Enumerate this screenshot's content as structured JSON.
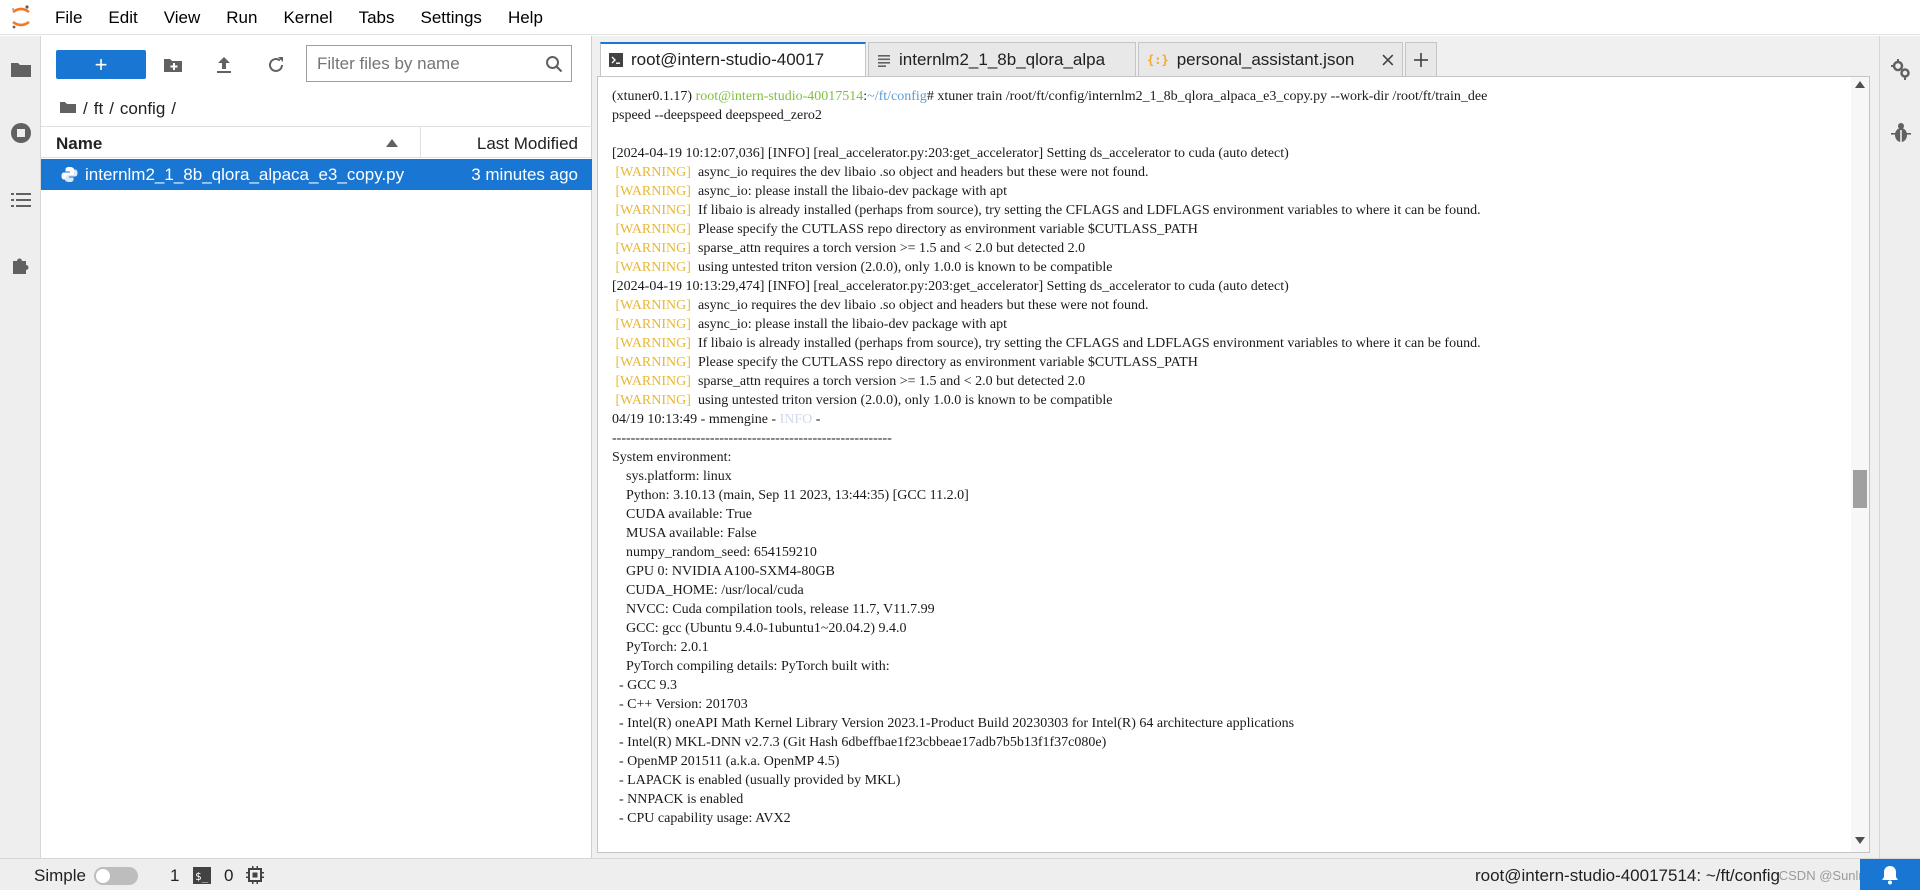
{
  "menu": {
    "items": [
      "File",
      "Edit",
      "View",
      "Run",
      "Kernel",
      "Tabs",
      "Settings",
      "Help"
    ]
  },
  "left_strip": {
    "icons": [
      "folder-icon",
      "running-icon",
      "toc-icon",
      "extension-icon"
    ]
  },
  "file_browser": {
    "new_label": "+",
    "filter_placeholder": "Filter files by name",
    "breadcrumb": [
      "ft",
      "config"
    ],
    "breadcrumb_sep": "/",
    "column_name": "Name",
    "column_modified": "Last Modified",
    "files": [
      {
        "name": "internlm2_1_8b_qlora_alpaca_e3_copy.py",
        "modified": "3 minutes ago",
        "selected": true
      }
    ]
  },
  "tabs": [
    {
      "label": "root@intern-studio-40017",
      "icon": "terminal-icon",
      "active": true
    },
    {
      "label": "internlm2_1_8b_qlora_alpa",
      "icon": "text-file-icon",
      "active": false
    },
    {
      "label": "personal_assistant.json",
      "icon": "json-icon",
      "active": false
    }
  ],
  "terminal": {
    "lines": [
      {
        "segments": [
          {
            "text": "(xtuner0.1.17) ",
            "cls": ""
          },
          {
            "text": "root@intern-studio-40017514",
            "cls": "t-green"
          },
          {
            "text": ":",
            "cls": ""
          },
          {
            "text": "~/ft/config",
            "cls": "t-blue"
          },
          {
            "text": "# xtuner train /root/ft/config/internlm2_1_8b_qlora_alpaca_e3_copy.py --work-dir /root/ft/train_dee",
            "cls": ""
          }
        ]
      },
      {
        "segments": [
          {
            "text": "pspeed --deepspeed deepspeed_zero2",
            "cls": ""
          }
        ]
      },
      {
        "segments": [
          {
            "text": "",
            "cls": ""
          }
        ]
      },
      {
        "segments": [
          {
            "text": "[2024-04-19 10:12:07,036] [INFO] [real_accelerator.py:203:get_accelerator] Setting ds_accelerator to cuda (auto detect)",
            "cls": ""
          }
        ]
      },
      {
        "segments": [
          {
            "text": " [WARNING] ",
            "cls": "t-warn"
          },
          {
            "text": " async_io requires the dev libaio .so object and headers but these were not found.",
            "cls": ""
          }
        ]
      },
      {
        "segments": [
          {
            "text": " [WARNING] ",
            "cls": "t-warn"
          },
          {
            "text": " async_io: please install the libaio-dev package with apt",
            "cls": ""
          }
        ]
      },
      {
        "segments": [
          {
            "text": " [WARNING] ",
            "cls": "t-warn"
          },
          {
            "text": " If libaio is already installed (perhaps from source), try setting the CFLAGS and LDFLAGS environment variables to where it can be found.",
            "cls": ""
          }
        ]
      },
      {
        "segments": [
          {
            "text": " [WARNING] ",
            "cls": "t-warn"
          },
          {
            "text": " Please specify the CUTLASS repo directory as environment variable $CUTLASS_PATH",
            "cls": ""
          }
        ]
      },
      {
        "segments": [
          {
            "text": " [WARNING] ",
            "cls": "t-warn"
          },
          {
            "text": " sparse_attn requires a torch version >= 1.5 and < 2.0 but detected 2.0",
            "cls": ""
          }
        ]
      },
      {
        "segments": [
          {
            "text": " [WARNING] ",
            "cls": "t-warn"
          },
          {
            "text": " using untested triton version (2.0.0), only 1.0.0 is known to be compatible",
            "cls": ""
          }
        ]
      },
      {
        "segments": [
          {
            "text": "[2024-04-19 10:13:29,474] [INFO] [real_accelerator.py:203:get_accelerator] Setting ds_accelerator to cuda (auto detect)",
            "cls": ""
          }
        ]
      },
      {
        "segments": [
          {
            "text": " [WARNING] ",
            "cls": "t-warn"
          },
          {
            "text": " async_io requires the dev libaio .so object and headers but these were not found.",
            "cls": ""
          }
        ]
      },
      {
        "segments": [
          {
            "text": " [WARNING] ",
            "cls": "t-warn"
          },
          {
            "text": " async_io: please install the libaio-dev package with apt",
            "cls": ""
          }
        ]
      },
      {
        "segments": [
          {
            "text": " [WARNING] ",
            "cls": "t-warn"
          },
          {
            "text": " If libaio is already installed (perhaps from source), try setting the CFLAGS and LDFLAGS environment variables to where it can be found.",
            "cls": ""
          }
        ]
      },
      {
        "segments": [
          {
            "text": " [WARNING] ",
            "cls": "t-warn"
          },
          {
            "text": " Please specify the CUTLASS repo directory as environment variable $CUTLASS_PATH",
            "cls": ""
          }
        ]
      },
      {
        "segments": [
          {
            "text": " [WARNING] ",
            "cls": "t-warn"
          },
          {
            "text": " sparse_attn requires a torch version >= 1.5 and < 2.0 but detected 2.0",
            "cls": ""
          }
        ]
      },
      {
        "segments": [
          {
            "text": " [WARNING] ",
            "cls": "t-warn"
          },
          {
            "text": " using untested triton version (2.0.0), only 1.0.0 is known to be compatible",
            "cls": ""
          }
        ]
      },
      {
        "segments": [
          {
            "text": "04/19 10:13:49 - mmengine - ",
            "cls": ""
          },
          {
            "text": "INFO",
            "cls": "t-info"
          },
          {
            "text": " -",
            "cls": ""
          }
        ]
      },
      {
        "segments": [
          {
            "text": "------------------------------------------------------------",
            "cls": ""
          }
        ]
      },
      {
        "segments": [
          {
            "text": "System environment:",
            "cls": ""
          }
        ]
      },
      {
        "segments": [
          {
            "text": "    sys.platform: linux",
            "cls": ""
          }
        ]
      },
      {
        "segments": [
          {
            "text": "    Python: 3.10.13 (main, Sep 11 2023, 13:44:35) [GCC 11.2.0]",
            "cls": ""
          }
        ]
      },
      {
        "segments": [
          {
            "text": "    CUDA available: True",
            "cls": ""
          }
        ]
      },
      {
        "segments": [
          {
            "text": "    MUSA available: False",
            "cls": ""
          }
        ]
      },
      {
        "segments": [
          {
            "text": "    numpy_random_seed: 654159210",
            "cls": ""
          }
        ]
      },
      {
        "segments": [
          {
            "text": "    GPU 0: NVIDIA A100-SXM4-80GB",
            "cls": ""
          }
        ]
      },
      {
        "segments": [
          {
            "text": "    CUDA_HOME: /usr/local/cuda",
            "cls": ""
          }
        ]
      },
      {
        "segments": [
          {
            "text": "    NVCC: Cuda compilation tools, release 11.7, V11.7.99",
            "cls": ""
          }
        ]
      },
      {
        "segments": [
          {
            "text": "    GCC: gcc (Ubuntu 9.4.0-1ubuntu1~20.04.2) 9.4.0",
            "cls": ""
          }
        ]
      },
      {
        "segments": [
          {
            "text": "    PyTorch: 2.0.1",
            "cls": ""
          }
        ]
      },
      {
        "segments": [
          {
            "text": "    PyTorch compiling details: PyTorch built with:",
            "cls": ""
          }
        ]
      },
      {
        "segments": [
          {
            "text": "  - GCC 9.3",
            "cls": ""
          }
        ]
      },
      {
        "segments": [
          {
            "text": "  - C++ Version: 201703",
            "cls": ""
          }
        ]
      },
      {
        "segments": [
          {
            "text": "  - Intel(R) oneAPI Math Kernel Library Version 2023.1-Product Build 20230303 for Intel(R) 64 architecture applications",
            "cls": ""
          }
        ]
      },
      {
        "segments": [
          {
            "text": "  - Intel(R) MKL-DNN v2.7.3 (Git Hash 6dbeffbae1f23cbbeae17adb7b5b13f1f37c080e)",
            "cls": ""
          }
        ]
      },
      {
        "segments": [
          {
            "text": "  - OpenMP 201511 (a.k.a. OpenMP 4.5)",
            "cls": ""
          }
        ]
      },
      {
        "segments": [
          {
            "text": "  - LAPACK is enabled (usually provided by MKL)",
            "cls": ""
          }
        ]
      },
      {
        "segments": [
          {
            "text": "  - NNPACK is enabled",
            "cls": ""
          }
        ]
      },
      {
        "segments": [
          {
            "text": "  - CPU capability usage: AVX2",
            "cls": ""
          }
        ]
      }
    ]
  },
  "statusbar": {
    "mode_label": "Simple",
    "terminals_count": "1",
    "kernels_count": "0",
    "path": "root@intern-studio-40017514: ~/ft/config",
    "watermark": "CSDN @SunlnCasa"
  },
  "colors": {
    "accent": "#1976d2",
    "warning": "#e8b834",
    "prompt_user": "#7fbf3f",
    "prompt_path": "#5b9bd5"
  }
}
